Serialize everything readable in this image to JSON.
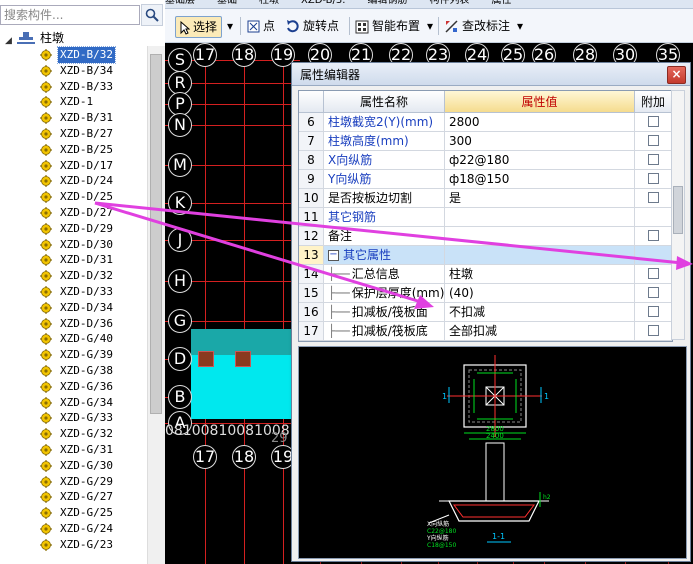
{
  "search": {
    "placeholder": "搜索构件..."
  },
  "tree": {
    "root_label": "柱墩",
    "items": [
      "XZD-B/32",
      "XZD-B/34",
      "XZD-B/33",
      "XZD-1",
      "XZD-B/31",
      "XZD-B/27",
      "XZD-B/25",
      "XZD-D/17",
      "XZD-D/24",
      "XZD-D/25",
      "XZD-D/27",
      "XZD-D/29",
      "XZD-D/30",
      "XZD-D/31",
      "XZD-D/32",
      "XZD-D/33",
      "XZD-D/34",
      "XZD-D/36",
      "XZD-G/40",
      "XZD-G/39",
      "XZD-G/38",
      "XZD-G/36",
      "XZD-G/34",
      "XZD-G/33",
      "XZD-G/32",
      "XZD-G/31",
      "XZD-G/30",
      "XZD-G/29",
      "XZD-G/27",
      "XZD-G/25",
      "XZD-G/24",
      "XZD-G/23"
    ],
    "selected_index": 0
  },
  "topstrip": [
    "基础层",
    "基础",
    "柱墩",
    "XZD-B/3.",
    "编辑钢筋",
    "构件列表",
    "属性"
  ],
  "toolbar": {
    "select": "选择",
    "point": "点",
    "rotate_point": "旋转点",
    "smart_layout": "智能布置",
    "edit_annotation": "查改标注"
  },
  "canvas": {
    "top_axis": [
      "17",
      "18",
      "19",
      "20",
      "21",
      "22",
      "23",
      "24",
      "25",
      "26",
      "28",
      "30",
      "35"
    ],
    "left_axis": [
      "S",
      "R",
      "P",
      "N",
      "M",
      "K",
      "J",
      "H",
      "G",
      "D",
      "B",
      "A"
    ],
    "bottom_axis": [
      "17",
      "18",
      "19"
    ],
    "bottom_dim_text": "08100810081008100",
    "bottom_small": "29"
  },
  "dialog": {
    "title": "属性编辑器",
    "close": "×",
    "headers": {
      "name": "属性名称",
      "value": "属性值",
      "attach": "附加"
    },
    "rows": [
      {
        "num": "6",
        "name": "柱墩截宽2(Y)(mm)",
        "value": "2800",
        "blue": true,
        "checkbox": true
      },
      {
        "num": "7",
        "name": "柱墩高度(mm)",
        "value": "300",
        "blue": true,
        "checkbox": true
      },
      {
        "num": "8",
        "name": "X向纵筋",
        "value": "ф22@180",
        "blue": true,
        "checkbox": true
      },
      {
        "num": "9",
        "name": "Y向纵筋",
        "value": "ф18@150",
        "blue": true,
        "checkbox": true
      },
      {
        "num": "10",
        "name": "是否按板边切割",
        "value": "是",
        "blue": false,
        "checkbox": true
      },
      {
        "num": "11",
        "name": "其它钢筋",
        "value": "",
        "blue": true,
        "checkbox": false
      },
      {
        "num": "12",
        "name": "备注",
        "value": "",
        "blue": false,
        "checkbox": true
      },
      {
        "num": "13",
        "name": "其它属性",
        "value": "",
        "blue": true,
        "checkbox": false,
        "group": true
      },
      {
        "num": "14",
        "name": "汇总信息",
        "value": "柱墩",
        "blue": false,
        "checkbox": true,
        "child": true
      },
      {
        "num": "15",
        "name": "保护层厚度(mm)",
        "value": "(40)",
        "blue": false,
        "checkbox": true,
        "child": true
      },
      {
        "num": "16",
        "name": "扣减板/筏板面",
        "value": "不扣减",
        "blue": false,
        "checkbox": true,
        "child": true
      },
      {
        "num": "17",
        "name": "扣减板/筏板底",
        "value": "全部扣减",
        "blue": false,
        "checkbox": true,
        "child": true
      }
    ],
    "preview": {
      "label_1a": "1",
      "label_1b": "1",
      "dim_2800": "2800",
      "dim_2400": "2400",
      "xbar": "X向纵筋",
      "xbar_val": "C22@180",
      "ybar": "Y向纵筋",
      "ybar_val": "C18@150",
      "section": "1-1",
      "side": "h2"
    }
  },
  "colors": {
    "arrow": "#e040e0",
    "grid": "#d42020",
    "cyan": "#00e8ee",
    "selection": "#316ac5"
  }
}
